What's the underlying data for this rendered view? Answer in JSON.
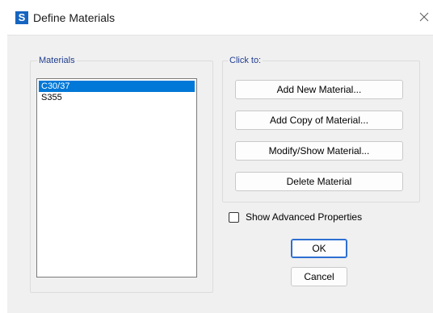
{
  "window": {
    "title": "Define Materials",
    "app_icon_letter": "S"
  },
  "materials_group": {
    "label": "Materials",
    "items": [
      {
        "label": "C30/37",
        "selected": true
      },
      {
        "label": "S355",
        "selected": false
      }
    ]
  },
  "actions_group": {
    "label": "Click to:",
    "buttons": {
      "add_new": "Add New Material...",
      "add_copy": "Add Copy of Material...",
      "modify_show": "Modify/Show Material...",
      "delete": "Delete Material"
    }
  },
  "advanced": {
    "label": "Show Advanced Properties",
    "checked": false
  },
  "dialog_buttons": {
    "ok": "OK",
    "cancel": "Cancel"
  },
  "colors": {
    "selection": "#0078d7",
    "group_label": "#1f3d8f",
    "app_icon": "#1565c0"
  }
}
